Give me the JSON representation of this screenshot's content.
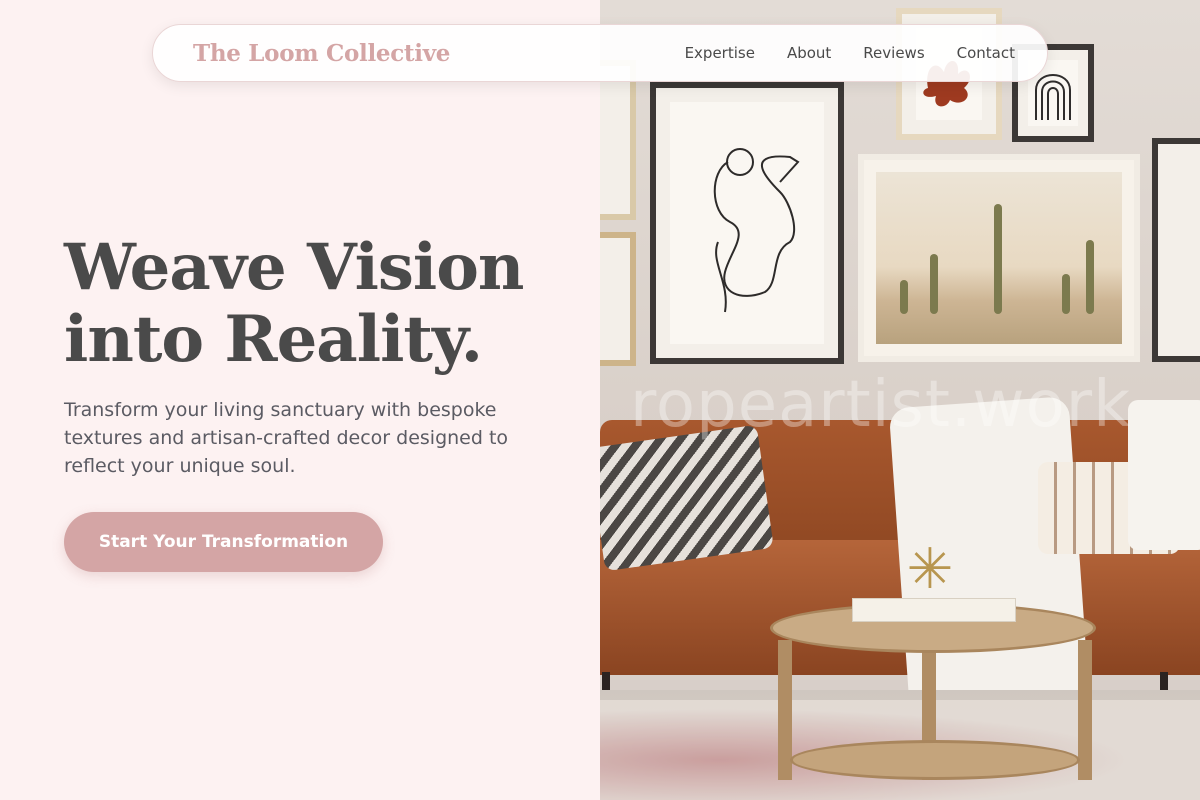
{
  "nav": {
    "brand": "The Loom Collective",
    "links": [
      "Expertise",
      "About",
      "Reviews",
      "Contact"
    ]
  },
  "hero": {
    "title_line1": "Weave Vision",
    "title_line2": "into Reality.",
    "subtitle": "Transform your living sanctuary with bespoke textures and artisan-crafted decor designed to reflect your unique soul.",
    "cta_label": "Start Your Transformation"
  },
  "image": {
    "watermark": "ropeartist.work"
  },
  "colors": {
    "background": "#fdf2f2",
    "accent": "#d4a5a5",
    "heading": "#4a4a4a",
    "body_text": "#5b5b63"
  }
}
